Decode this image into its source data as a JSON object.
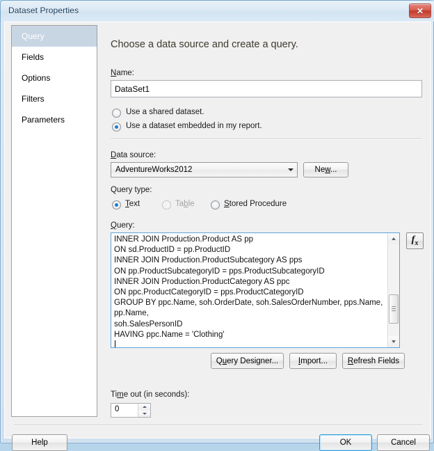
{
  "window": {
    "title": "Dataset Properties",
    "close_label": "✕"
  },
  "sidebar": {
    "items": [
      {
        "label": "Query",
        "selected": true
      },
      {
        "label": "Fields",
        "selected": false
      },
      {
        "label": "Options",
        "selected": false
      },
      {
        "label": "Filters",
        "selected": false
      },
      {
        "label": "Parameters",
        "selected": false
      }
    ]
  },
  "main": {
    "heading": "Choose a data source and create a query.",
    "name_label": "Name:",
    "name_value": "DataSet1",
    "dataset_source_options": [
      {
        "label": "Use a shared dataset.",
        "checked": false,
        "disabled": false
      },
      {
        "label": "Use a dataset embedded in my report.",
        "checked": true,
        "disabled": false
      }
    ],
    "data_source_label": "Data source:",
    "data_source_value": "AdventureWorks2012",
    "new_button": "New...",
    "query_type_label": "Query type:",
    "query_type_options": [
      {
        "label": "Text",
        "checked": true,
        "disabled": false
      },
      {
        "label": "Table",
        "checked": false,
        "disabled": true
      },
      {
        "label": "Stored Procedure",
        "checked": false,
        "disabled": false
      }
    ],
    "query_label": "Query:",
    "query_text": "INNER JOIN Production.Product AS pp\nON sd.ProductID = pp.ProductID\nINNER JOIN Production.ProductSubcategory AS pps\nON pp.ProductSubcategoryID = pps.ProductSubcategoryID\nINNER JOIN Production.ProductCategory AS ppc\nON ppc.ProductCategoryID = pps.ProductCategoryID\nGROUP BY ppc.Name, soh.OrderDate, soh.SalesOrderNumber, pps.Name,\npp.Name,\nsoh.SalesPersonID\nHAVING ppc.Name = 'Clothing'",
    "fx_label": "fx",
    "query_designer_button": "Query Designer...",
    "import_button": "Import...",
    "refresh_fields_button": "Refresh Fields",
    "timeout_label": "Time out (in seconds):",
    "timeout_value": "0"
  },
  "footer": {
    "help_button": "Help",
    "ok_button": "OK",
    "cancel_button": "Cancel"
  },
  "colors": {
    "accent": "#2c9ade",
    "selection": "#c8d5e3",
    "radio_dot": "#1b7fd4",
    "close_red": "#c2392c"
  }
}
